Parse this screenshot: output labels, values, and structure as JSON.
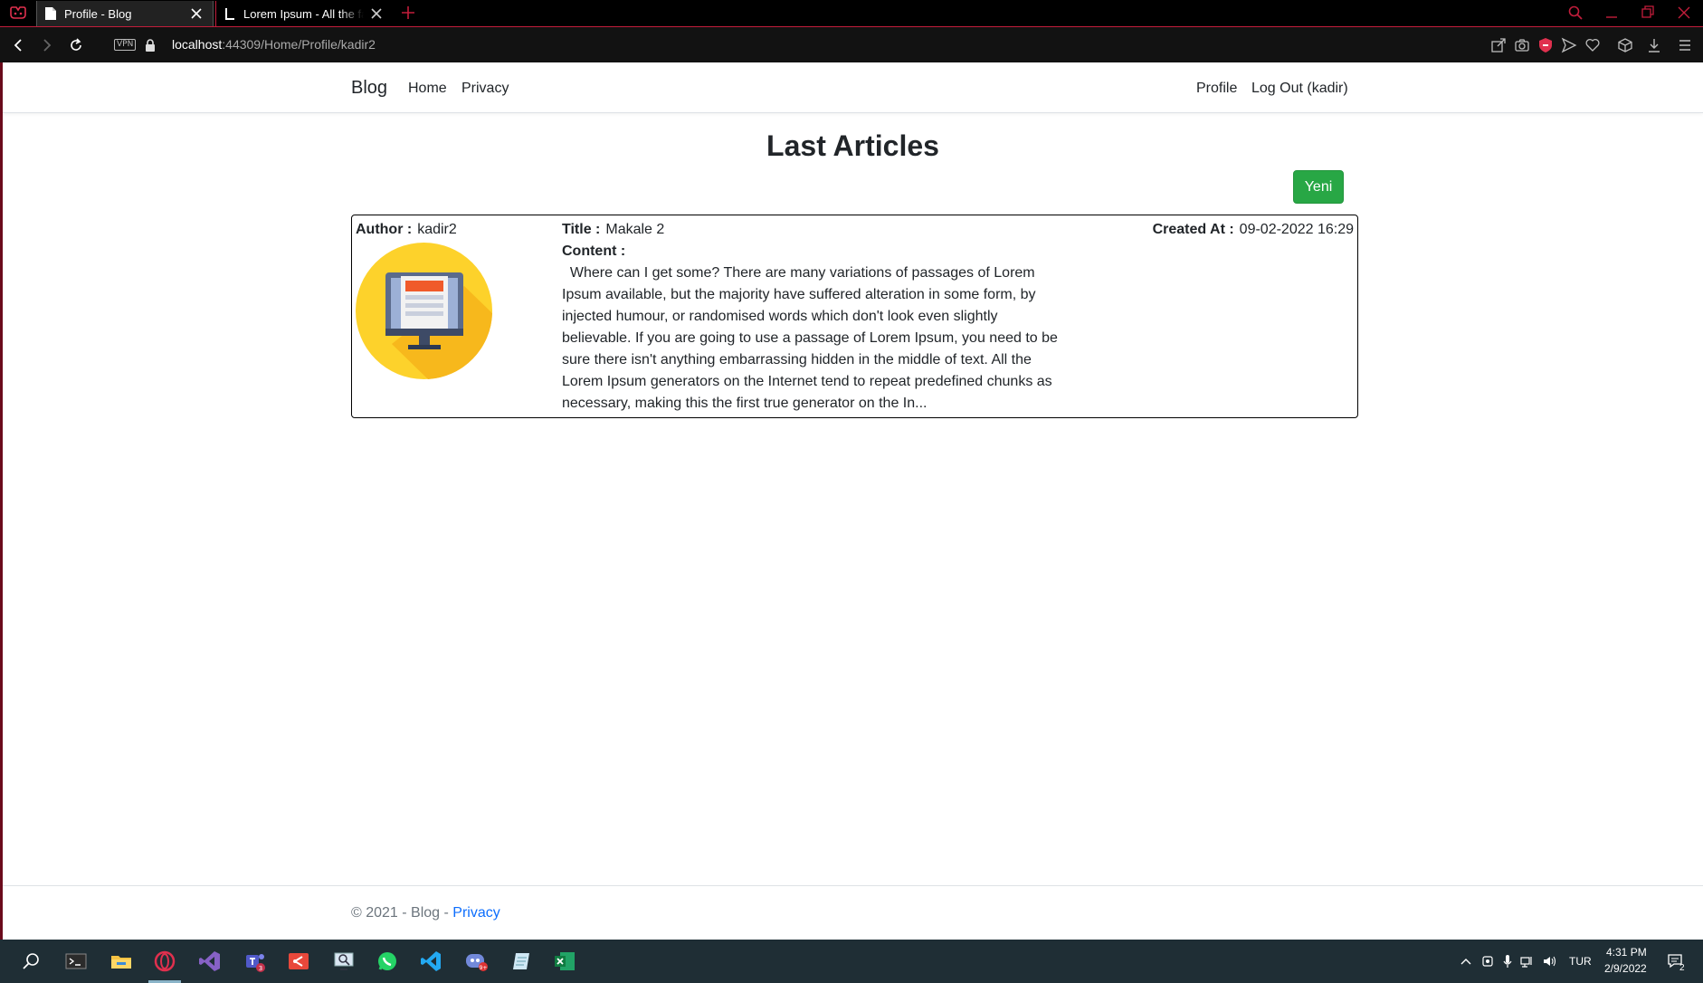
{
  "browser": {
    "tabs": [
      {
        "title": "Profile - Blog",
        "active": true
      },
      {
        "title": "Lorem Ipsum - All the facts",
        "active": false
      }
    ],
    "url_host": "localhost",
    "url_path": ":44309/Home/Profile/kadir2",
    "vpn_label": "VPN"
  },
  "navbar": {
    "brand": "Blog",
    "links": [
      "Home",
      "Privacy"
    ],
    "right_links": [
      "Profile",
      "Log Out (kadir)"
    ]
  },
  "main": {
    "heading": "Last Articles",
    "new_button_label": "Yeni",
    "article": {
      "author_label": "Author :",
      "author": "kadir2",
      "title_label": "Title :",
      "title": "Makale 2",
      "content_label": "Content :",
      "content": "  Where can I get some? There are many variations of passages of Lorem Ipsum available, but the majority have suffered alteration in some form, by injected humour, or randomised words which don't look even slightly believable. If you are going to use a passage of Lorem Ipsum, you need to be sure there isn't anything embarrassing hidden in the middle of text. All the Lorem Ipsum generators on the Internet tend to repeat predefined chunks as necessary, making this the first true generator on the In...",
      "created_label": "Created At :",
      "created_at": "09-02-2022 16:29"
    }
  },
  "footer": {
    "text": "© 2021 - Blog - ",
    "link": "Privacy"
  },
  "taskbar": {
    "language": "TUR",
    "time": "4:31 PM",
    "date": "2/9/2022",
    "notification_count": "2"
  },
  "colors": {
    "accent_red": "#c21d3b",
    "success_green": "#28a745",
    "link_blue": "#0d6efd",
    "taskbar": "#1f2e35"
  }
}
